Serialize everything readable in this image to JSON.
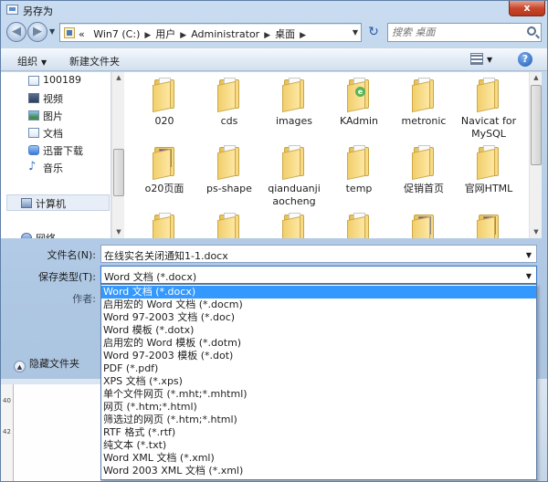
{
  "window": {
    "title": "另存为",
    "close_label": "x"
  },
  "address": {
    "lead": "«",
    "crumbs": [
      "Win7 (C:)",
      "用户",
      "Administrator",
      "桌面"
    ]
  },
  "search": {
    "placeholder": "搜索 桌面"
  },
  "toolbar": {
    "organize": "组织",
    "new_folder": "新建文件夹",
    "help": "?"
  },
  "nav": {
    "items": [
      {
        "label": "100189",
        "icon": "document-icon"
      },
      {
        "label": "视频",
        "icon": "video-icon"
      },
      {
        "label": "图片",
        "icon": "picture-icon"
      },
      {
        "label": "文档",
        "icon": "document-icon"
      },
      {
        "label": "迅雷下载",
        "icon": "thunder-icon"
      },
      {
        "label": "音乐",
        "icon": "music-icon"
      },
      {
        "label": "计算机",
        "icon": "computer-icon"
      },
      {
        "label": "网络",
        "icon": "network-icon"
      }
    ]
  },
  "files": {
    "items": [
      {
        "label": "020",
        "icon": "folder-icon"
      },
      {
        "label": "cds",
        "icon": "folder-icon"
      },
      {
        "label": "images",
        "icon": "folder-icon"
      },
      {
        "label": "KAdmin",
        "icon": "folder-icon"
      },
      {
        "label": "metronic",
        "icon": "folder-icon"
      },
      {
        "label": "Navicat for MySQL",
        "icon": "folder-icon"
      },
      {
        "label": "o20页面",
        "icon": "folder-icon"
      },
      {
        "label": "ps-shape",
        "icon": "folder-icon"
      },
      {
        "label": "qianduanji aocheng",
        "icon": "folder-icon"
      },
      {
        "label": "temp",
        "icon": "folder-icon"
      },
      {
        "label": "促销首页",
        "icon": "folder-icon"
      },
      {
        "label": "官网HTML",
        "icon": "folder-icon"
      }
    ]
  },
  "form": {
    "filename_label": "文件名(N):",
    "filename_value": "在线实名关闭通知1-1.docx",
    "filetype_label": "保存类型(T):",
    "filetype_value": "Word 文档 (*.docx)",
    "author_label": "作者:"
  },
  "filetype_options": [
    "Word 文档 (*.docx)",
    "启用宏的 Word 文档 (*.docm)",
    "Word 97-2003 文档 (*.doc)",
    "Word 模板 (*.dotx)",
    "启用宏的 Word 模板 (*.dotm)",
    "Word 97-2003 模板 (*.dot)",
    "PDF (*.pdf)",
    "XPS 文档 (*.xps)",
    "单个文件网页 (*.mht;*.mhtml)",
    "网页 (*.htm;*.html)",
    "筛选过的网页 (*.htm;*.html)",
    "RTF 格式 (*.rtf)",
    "纯文本 (*.txt)",
    "Word XML 文档 (*.xml)",
    "Word 2003 XML 文档 (*.xml)"
  ],
  "hide_folders": "隐藏文件夹",
  "ruler": [
    "40",
    "42"
  ]
}
